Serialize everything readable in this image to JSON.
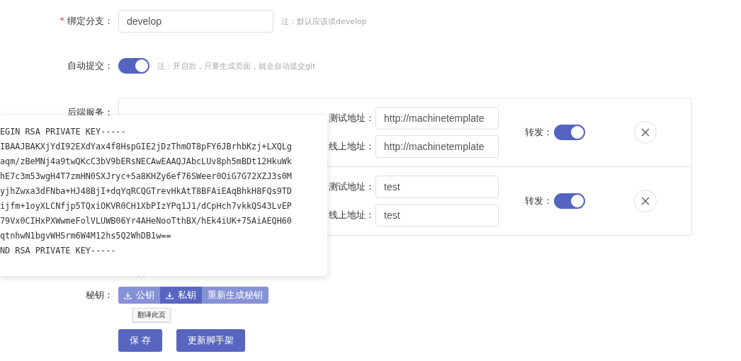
{
  "branch": {
    "label": "绑定分支：",
    "required_mark": "*",
    "value": "develop",
    "note": "注：默认应该填develop"
  },
  "auto_commit": {
    "label": "自动提交：",
    "on": true,
    "note": "注：开启后，只要生成页面，就会自动提交git"
  },
  "backend": {
    "label": "后端服务：",
    "services": [
      {
        "test_label": "测试地址：",
        "test_value": "http://machinetemplate",
        "prod_label": "线上地址：",
        "prod_value": "http://machinetemplate",
        "forward_label": "转发：",
        "forward_on": true
      },
      {
        "test_label": "测试地址：",
        "test_value": "test",
        "prod_label": "线上地址：",
        "prod_value": "test",
        "forward_label": "转发：",
        "forward_on": true
      }
    ]
  },
  "key_popover": {
    "lines": [
      "EGIN RSA PRIVATE KEY-----",
      "IBAAJBAKXjYdI92EXdYax4f8HspGIE2jDzThmOT8pFY6JBrhbKzj+LXQLg",
      "aqm/zBeMNj4a9twQKcC3bV9bERsNECAwEAAQJAbcLUv8ph5mBDt12HkuWk",
      "hE7c3m53wgH4T7zmHN0SXJryc+5a8KHZy6ef76SWeer0OiG7G72XZJ3s0M",
      "yjhZwxa3dFNba+HJ48BjI+dqYqRCQGTrevHkAtT8BFAiEAqBhkH8FQs9TD",
      "ijfm+1oyXLCNfjp5TQxiOKVR0CH1XbPIzYPq1J1/dCpHch7vkkQS43LvEP",
      "79Vx0CIHxPXWwmeFolVLUWB06Yr4AHeNooTthBX/hEk4iUK+75AiAEQH60",
      "qtnhwN1bgvWHSrm6W4M12hs5Q2WhDB1w==",
      "ND RSA PRIVATE KEY-----"
    ]
  },
  "secret": {
    "label": "秘钥：",
    "buttons": [
      {
        "label": "公钥",
        "kind": "download",
        "selected": false
      },
      {
        "label": "私钥",
        "kind": "download",
        "selected": true
      },
      {
        "label": "重新生成秘钥",
        "kind": "plain",
        "selected": false
      }
    ],
    "tooltip": "翻译此页"
  },
  "actions": [
    "保 存",
    "更新脚手架"
  ]
}
